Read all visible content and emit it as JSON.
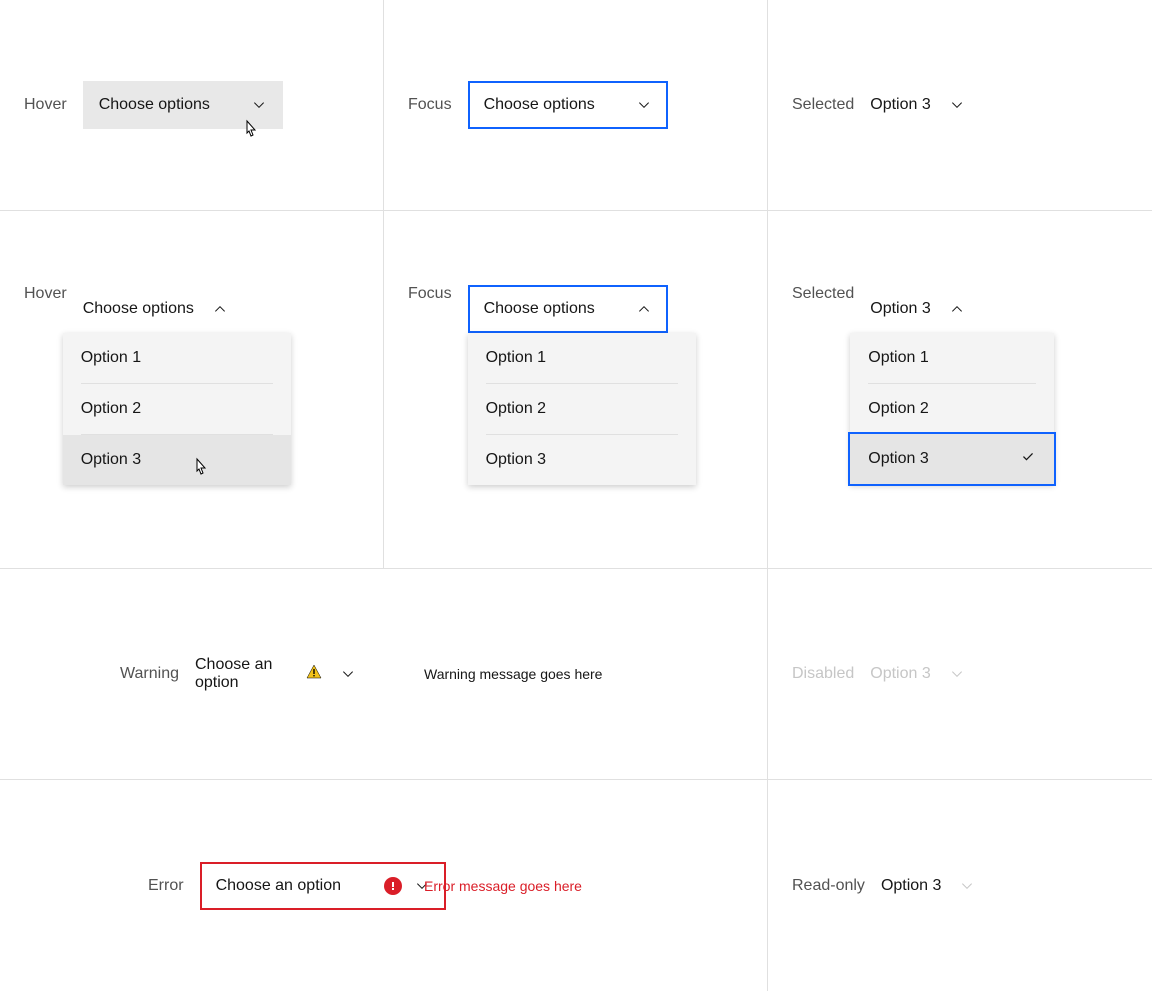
{
  "states": {
    "hover": "Hover",
    "focus": "Focus",
    "selected": "Selected",
    "warning": "Warning",
    "disabled": "Disabled",
    "error": "Error",
    "readonly": "Read-only"
  },
  "placeholder": "Choose options",
  "placeholder_single": "Choose an option",
  "options": {
    "o1": "Option 1",
    "o2": "Option 2",
    "o3": "Option 3"
  },
  "selected_value": "Option 3",
  "messages": {
    "warning": "Warning message goes here",
    "error": "Error message goes here"
  },
  "colors": {
    "focus": "#0f62fe",
    "error": "#da1e28",
    "warning": "#f1c21b",
    "text": "#161616",
    "muted": "#525252",
    "disabled": "#c6c6c6",
    "hoverBg": "#e8e8e8",
    "menuBg": "#f4f4f4"
  }
}
